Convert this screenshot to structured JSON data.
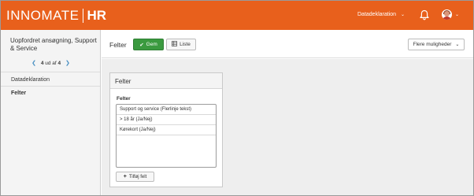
{
  "header": {
    "logo_main": "INNOMATE",
    "logo_suffix": "HR",
    "menu_label": "Datadeklaration",
    "icons": {
      "notifications": "bell-icon",
      "profile": "avatar-icon",
      "dropdown": "chevron-down-icon"
    }
  },
  "sidebar": {
    "job_title": "Uopfordret ansøgning, Support & Service",
    "pager": {
      "current": "4",
      "of_text": "ud af",
      "total": "4"
    },
    "items": [
      {
        "label": "Datadeklaration",
        "active": false
      },
      {
        "label": "Felter",
        "active": true
      }
    ]
  },
  "toolbar": {
    "title": "Felter",
    "save_label": "Gem",
    "list_label": "Liste",
    "more_label": "Flere muligheder"
  },
  "panel": {
    "title": "Felter",
    "fields_label": "Felter",
    "fields": [
      "Support og service (Flerlinje tekst)",
      "> 18 år (Ja/Nej)",
      "Kørekort (Ja/Nej)"
    ],
    "add_label": "Tilføj felt"
  },
  "colors": {
    "brand": "#e8601c",
    "save_button": "#3a9a3f",
    "pager_arrow": "#4a90c2"
  }
}
